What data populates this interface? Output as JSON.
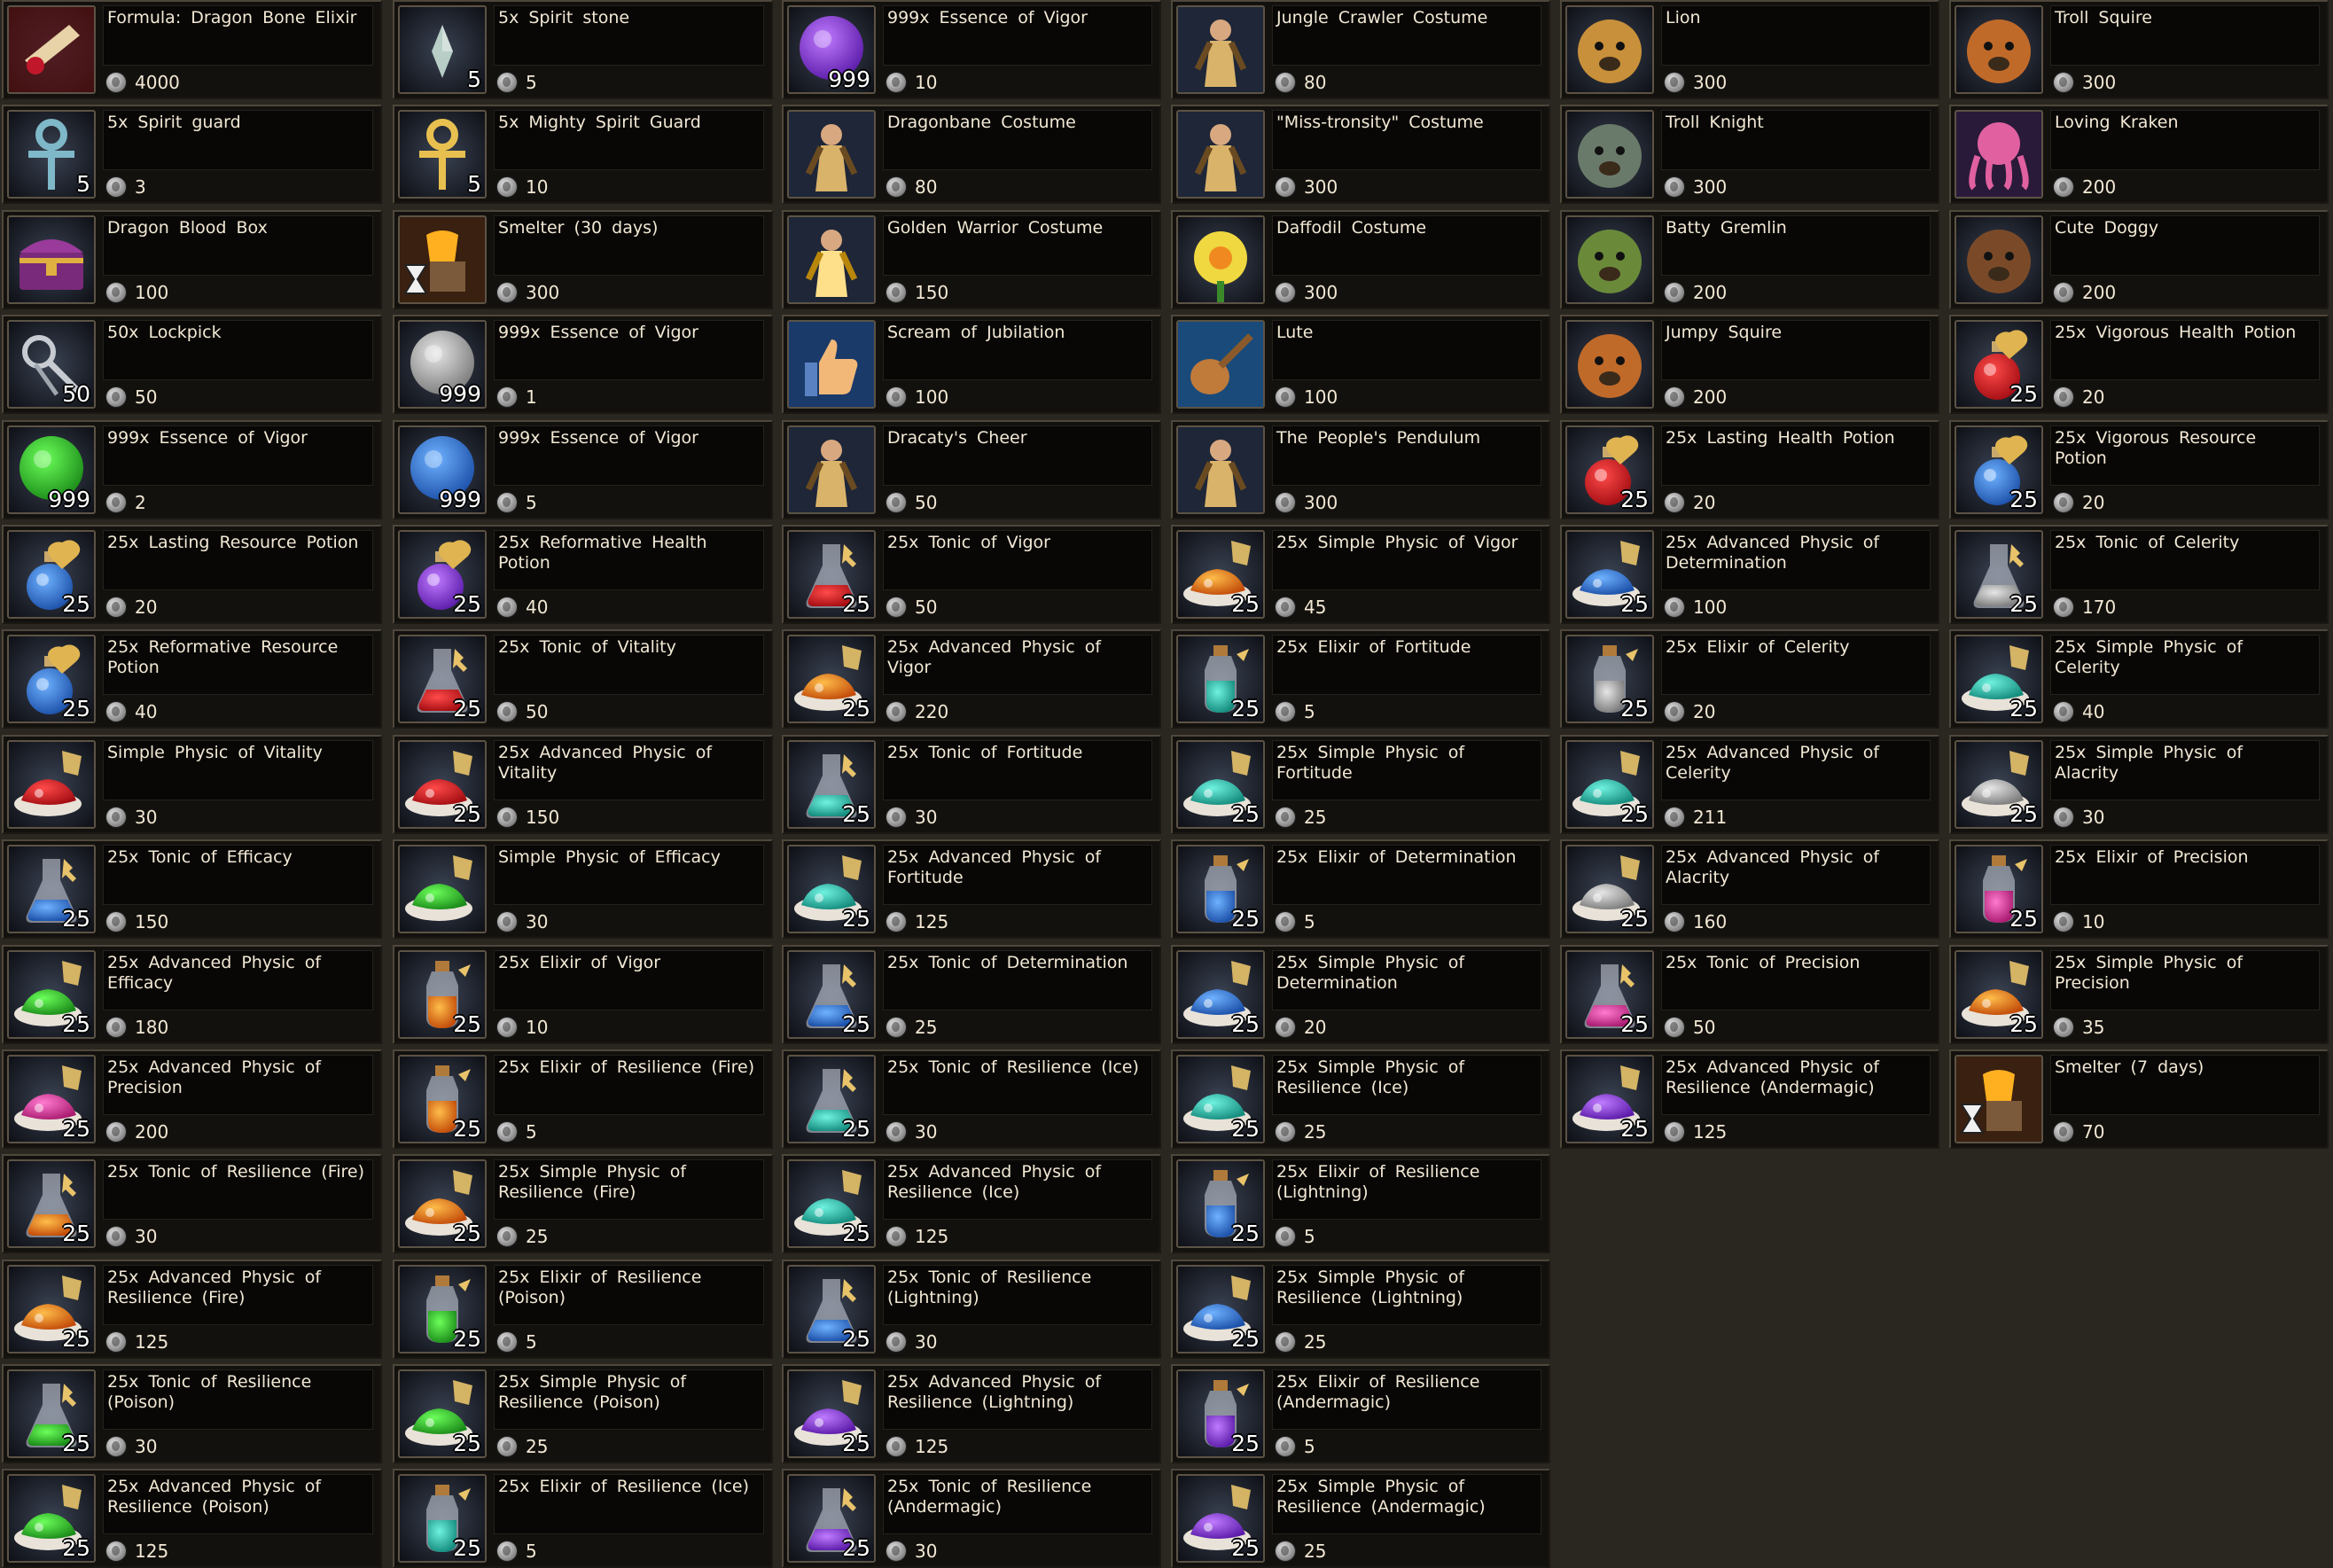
{
  "columns": [
    [
      {
        "name": "Formula:  Dragon  Bone  Elixir",
        "price": "4000",
        "qty": "",
        "icon": "scroll-icon"
      },
      {
        "name": "5x  Spirit  guard",
        "price": "3",
        "qty": "5",
        "icon": "ankh-icon"
      },
      {
        "name": "Dragon  Blood  Box",
        "price": "100",
        "qty": "",
        "icon": "chest-icon"
      },
      {
        "name": "50x  Lockpick",
        "price": "50",
        "qty": "50",
        "icon": "lockpick-icon"
      },
      {
        "name": "999x  Essence  of  Vigor",
        "price": "2",
        "qty": "999",
        "icon": "green-orb-icon"
      },
      {
        "name": "25x  Lasting  Resource  Potion",
        "price": "20",
        "qty": "25",
        "icon": "blue-potion-icon"
      },
      {
        "name": "25x  Reformative  Resource  Potion",
        "price": "40",
        "qty": "25",
        "icon": "blue-potion-icon"
      },
      {
        "name": "Simple  Physic  of  Vitality",
        "price": "30",
        "qty": "",
        "icon": "red-physic-icon"
      },
      {
        "name": "25x  Tonic  of  Efficacy",
        "price": "150",
        "qty": "25",
        "icon": "blue-flask-icon"
      },
      {
        "name": "25x  Advanced  Physic  of  Efficacy",
        "price": "180",
        "qty": "25",
        "icon": "green-physic-icon"
      },
      {
        "name": "25x  Advanced  Physic  of  Precision",
        "price": "200",
        "qty": "25",
        "icon": "pink-physic-icon"
      },
      {
        "name": "25x  Tonic  of  Resilience  (Fire)",
        "price": "30",
        "qty": "25",
        "icon": "orange-flask-icon"
      },
      {
        "name": "25x  Advanced  Physic  of  Resilience  (Fire)",
        "price": "125",
        "qty": "25",
        "icon": "orange-physic-icon"
      },
      {
        "name": "25x  Tonic  of  Resilience  (Poison)",
        "price": "30",
        "qty": "25",
        "icon": "green-flask-icon"
      },
      {
        "name": "25x  Advanced  Physic  of  Resilience  (Poison)",
        "price": "125",
        "qty": "25",
        "icon": "green-physic-icon"
      }
    ],
    [
      {
        "name": "5x  Spirit  stone",
        "price": "5",
        "qty": "5",
        "icon": "crystal-icon"
      },
      {
        "name": "5x  Mighty  Spirit  Guard",
        "price": "10",
        "qty": "5",
        "icon": "gold-ankh-icon"
      },
      {
        "name": "Smelter  (30  days)",
        "price": "300",
        "qty": "",
        "icon": "smelter-icon"
      },
      {
        "name": "999x  Essence  of  Vigor",
        "price": "1",
        "qty": "999",
        "icon": "grey-orb-icon"
      },
      {
        "name": "999x  Essence  of  Vigor",
        "price": "5",
        "qty": "999",
        "icon": "blue-orb-icon"
      },
      {
        "name": "25x  Reformative  Health  Potion",
        "price": "40",
        "qty": "25",
        "icon": "purple-potion-icon"
      },
      {
        "name": "25x  Tonic  of  Vitality",
        "price": "50",
        "qty": "25",
        "icon": "red-flask-icon"
      },
      {
        "name": "25x  Advanced  Physic  of  Vitality",
        "price": "150",
        "qty": "25",
        "icon": "red-physic-icon"
      },
      {
        "name": "Simple  Physic  of  Efficacy",
        "price": "30",
        "qty": "",
        "icon": "green-physic-icon"
      },
      {
        "name": "25x  Elixir  of  Vigor",
        "price": "10",
        "qty": "25",
        "icon": "orange-elixir-icon"
      },
      {
        "name": "25x  Elixir  of  Resilience  (Fire)",
        "price": "5",
        "qty": "25",
        "icon": "orange-elixir-icon"
      },
      {
        "name": "25x  Simple  Physic  of  Resilience  (Fire)",
        "price": "25",
        "qty": "25",
        "icon": "orange-physic-icon"
      },
      {
        "name": "25x  Elixir  of  Resilience  (Poison)",
        "price": "5",
        "qty": "25",
        "icon": "green-elixir-icon"
      },
      {
        "name": "25x  Simple  Physic  of  Resilience  (Poison)",
        "price": "25",
        "qty": "25",
        "icon": "green-physic-icon"
      },
      {
        "name": "25x  Elixir  of  Resilience  (Ice)",
        "price": "5",
        "qty": "25",
        "icon": "teal-elixir-icon"
      }
    ],
    [
      {
        "name": "999x  Essence  of  Vigor",
        "price": "10",
        "qty": "999",
        "icon": "purple-orb-icon"
      },
      {
        "name": "Dragonbane  Costume",
        "price": "80",
        "qty": "",
        "icon": "dragonbane-costume-icon"
      },
      {
        "name": "Golden  Warrior  Costume",
        "price": "150",
        "qty": "",
        "icon": "golden-warrior-icon"
      },
      {
        "name": "Scream  of  Jubilation",
        "price": "100",
        "qty": "",
        "icon": "thumbs-up-icon"
      },
      {
        "name": "Dracaty's  Cheer",
        "price": "50",
        "qty": "",
        "icon": "cheer-icon"
      },
      {
        "name": "25x  Tonic  of  Vigor",
        "price": "50",
        "qty": "25",
        "icon": "red-flask-icon"
      },
      {
        "name": "25x  Advanced  Physic  of  Vigor",
        "price": "220",
        "qty": "25",
        "icon": "orange-physic-icon"
      },
      {
        "name": "25x  Tonic  of  Fortitude",
        "price": "30",
        "qty": "25",
        "icon": "teal-flask-icon"
      },
      {
        "name": "25x  Advanced  Physic  of  Fortitude",
        "price": "125",
        "qty": "25",
        "icon": "teal-physic-icon"
      },
      {
        "name": "25x  Tonic  of  Determination",
        "price": "25",
        "qty": "25",
        "icon": "blue-flask-icon"
      },
      {
        "name": "25x  Tonic  of  Resilience  (Ice)",
        "price": "30",
        "qty": "25",
        "icon": "teal-flask-icon"
      },
      {
        "name": "25x  Advanced  Physic  of  Resilience  (Ice)",
        "price": "125",
        "qty": "25",
        "icon": "teal-physic-icon"
      },
      {
        "name": "25x  Tonic  of  Resilience  (Lightning)",
        "price": "30",
        "qty": "25",
        "icon": "blue-flask-icon"
      },
      {
        "name": "25x  Advanced  Physic  of  Resilience  (Lightning)",
        "price": "125",
        "qty": "25",
        "icon": "purple-physic-icon"
      },
      {
        "name": "25x  Tonic  of  Resilience  (Andermagic)",
        "price": "30",
        "qty": "25",
        "icon": "purple-flask-icon"
      }
    ],
    [
      {
        "name": "Jungle  Crawler  Costume",
        "price": "80",
        "qty": "",
        "icon": "jungle-crawler-icon"
      },
      {
        "name": "\"Miss-tronsity\"  Costume",
        "price": "300",
        "qty": "",
        "icon": "misstronsity-icon"
      },
      {
        "name": "Daffodil  Costume",
        "price": "300",
        "qty": "",
        "icon": "daffodil-icon"
      },
      {
        "name": "Lute",
        "price": "100",
        "qty": "",
        "icon": "lute-icon"
      },
      {
        "name": "The  People's  Pendulum",
        "price": "300",
        "qty": "",
        "icon": "pendulum-icon"
      },
      {
        "name": "25x  Simple  Physic  of  Vigor",
        "price": "45",
        "qty": "25",
        "icon": "orange-physic-icon"
      },
      {
        "name": "25x  Elixir  of  Fortitude",
        "price": "5",
        "qty": "25",
        "icon": "teal-elixir-icon"
      },
      {
        "name": "25x  Simple  Physic  of  Fortitude",
        "price": "25",
        "qty": "25",
        "icon": "teal-physic-icon"
      },
      {
        "name": "25x  Elixir  of  Determination",
        "price": "5",
        "qty": "25",
        "icon": "blue-elixir-icon"
      },
      {
        "name": "25x  Simple  Physic  of  Determination",
        "price": "20",
        "qty": "25",
        "icon": "blue-physic-icon"
      },
      {
        "name": "25x  Simple  Physic  of  Resilience  (Ice)",
        "price": "25",
        "qty": "25",
        "icon": "teal-physic-icon"
      },
      {
        "name": "25x  Elixir  of  Resilience  (Lightning)",
        "price": "5",
        "qty": "25",
        "icon": "blue-elixir-icon"
      },
      {
        "name": "25x  Simple  Physic  of  Resilience  (Lightning)",
        "price": "25",
        "qty": "25",
        "icon": "blue-physic-icon"
      },
      {
        "name": "25x  Elixir  of  Resilience  (Andermagic)",
        "price": "5",
        "qty": "25",
        "icon": "purple-elixir-icon"
      },
      {
        "name": "25x  Simple  Physic  of  Resilience  (Andermagic)",
        "price": "25",
        "qty": "25",
        "icon": "purple-physic-icon"
      }
    ],
    [
      {
        "name": "Lion",
        "price": "300",
        "qty": "",
        "icon": "lion-icon"
      },
      {
        "name": "Troll  Knight",
        "price": "300",
        "qty": "",
        "icon": "troll-knight-icon"
      },
      {
        "name": "Batty  Gremlin",
        "price": "200",
        "qty": "",
        "icon": "gremlin-icon"
      },
      {
        "name": "Jumpy  Squire",
        "price": "200",
        "qty": "",
        "icon": "squire-icon"
      },
      {
        "name": "25x  Lasting  Health  Potion",
        "price": "20",
        "qty": "25",
        "icon": "red-potion-icon"
      },
      {
        "name": "25x  Advanced  Physic  of  Determination",
        "price": "100",
        "qty": "25",
        "icon": "blue-physic-icon"
      },
      {
        "name": "25x  Elixir  of  Celerity",
        "price": "20",
        "qty": "25",
        "icon": "grey-elixir-icon"
      },
      {
        "name": "25x  Advanced  Physic  of  Celerity",
        "price": "211",
        "qty": "25",
        "icon": "teal-physic-icon"
      },
      {
        "name": "25x  Advanced  Physic  of  Alacrity",
        "price": "160",
        "qty": "25",
        "icon": "grey-physic-icon"
      },
      {
        "name": "25x  Tonic  of  Precision",
        "price": "50",
        "qty": "25",
        "icon": "pink-flask-icon"
      },
      {
        "name": "25x  Advanced  Physic  of  Resilience  (Andermagic)",
        "price": "125",
        "qty": "25",
        "icon": "purple-physic-icon"
      }
    ],
    [
      {
        "name": "Troll  Squire",
        "price": "300",
        "qty": "",
        "icon": "troll-squire-icon"
      },
      {
        "name": "Loving  Kraken",
        "price": "200",
        "qty": "",
        "icon": "kraken-icon"
      },
      {
        "name": "Cute  Doggy",
        "price": "200",
        "qty": "",
        "icon": "doggy-icon"
      },
      {
        "name": "25x  Vigorous  Health  Potion",
        "price": "20",
        "qty": "25",
        "icon": "red-potion-icon"
      },
      {
        "name": "25x  Vigorous  Resource  Potion",
        "price": "20",
        "qty": "25",
        "icon": "blue-potion-icon"
      },
      {
        "name": "25x  Tonic  of  Celerity",
        "price": "170",
        "qty": "25",
        "icon": "grey-flask-icon"
      },
      {
        "name": "25x  Simple  Physic  of  Celerity",
        "price": "40",
        "qty": "25",
        "icon": "teal-physic-icon"
      },
      {
        "name": "25x  Simple  Physic  of  Alacrity",
        "price": "30",
        "qty": "25",
        "icon": "grey-physic-icon"
      },
      {
        "name": "25x  Elixir  of  Precision",
        "price": "10",
        "qty": "25",
        "icon": "pink-elixir-icon"
      },
      {
        "name": "25x  Simple  Physic  of  Precision",
        "price": "35",
        "qty": "25",
        "icon": "orange-physic-icon"
      },
      {
        "name": "Smelter  (7  days)",
        "price": "70",
        "qty": "",
        "icon": "smelter-icon"
      }
    ]
  ]
}
